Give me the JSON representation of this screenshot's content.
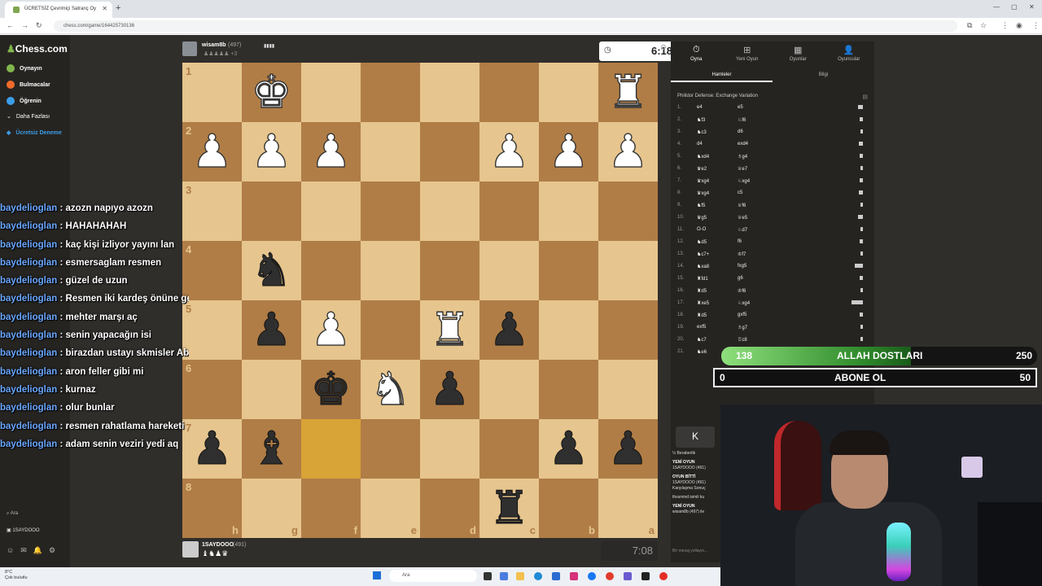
{
  "browser": {
    "tab_title": "ÜCRETSİZ Çevrimiçi Satranç Oy",
    "url": "chess.com/game/164425730136"
  },
  "sidebar": {
    "logo": "Chess.com",
    "items": [
      {
        "label": "Oynayın",
        "color": "#81b64c"
      },
      {
        "label": "Bulmacalar",
        "color": "#f06b2b"
      },
      {
        "label": "Öğrenin",
        "color": "#3b9ee8"
      },
      {
        "label": "Daha Fazlası",
        "color": "#888888"
      },
      {
        "label": "Ücretsiz Deneme",
        "color": "#3b9ee8"
      }
    ],
    "search_label": "Ara",
    "username": "1SAYDOOO"
  },
  "chat": [
    {
      "user": "baydelioglan",
      "text": "azozn napıyo azozn"
    },
    {
      "user": "baydelioglan",
      "text": "HAHAHAHAH"
    },
    {
      "user": "baydelioglan",
      "text": "kaç kişi izliyor yayını lan"
    },
    {
      "user": "baydelioglan",
      "text": "esmersaglam resmen"
    },
    {
      "user": "baydelioglan",
      "text": "güzel de uzun"
    },
    {
      "user": "baydelioglan",
      "text": "Resmen iki kardeş önüne geleni"
    },
    {
      "user": "baydelioglan",
      "text": "mehter marşı aç"
    },
    {
      "user": "baydelioglan",
      "text": "senin yapacağın isi"
    },
    {
      "user": "baydelioglan",
      "text": "birazdan ustayı skmisler Abdülhey olcak"
    },
    {
      "user": "baydelioglan",
      "text": "aron feller gibi mi"
    },
    {
      "user": "baydelioglan",
      "text": "kurnaz"
    },
    {
      "user": "baydelioglan",
      "text": "olur bunlar"
    },
    {
      "user": "baydelioglan",
      "text": "resmen rahatlama hareketi"
    },
    {
      "user": "baydelioglan",
      "text": "adam senin veziri yedi aq"
    }
  ],
  "top_player": {
    "name": "wisam8b",
    "rating": "(497)",
    "clock": "6:18",
    "captured": "♟♟♟♟♟ +3"
  },
  "bottom_player": {
    "name": "1SAYDOOO",
    "rating": "(491)",
    "clock": "7:08",
    "captured": "♝♞♟♛"
  },
  "board": {
    "ranks": [
      "1",
      "2",
      "3",
      "4",
      "5",
      "6",
      "7",
      "8"
    ],
    "files": [
      "h",
      "g",
      "f",
      "e",
      "d",
      "c",
      "b",
      "a"
    ],
    "rows": [
      [
        "",
        "♚w",
        "",
        "",
        "",
        "",
        "",
        "♜w"
      ],
      [
        "♟w",
        "♟w",
        "♟w",
        "",
        "",
        "♟w",
        "♟w",
        "♟w"
      ],
      [
        "",
        "",
        "",
        "",
        "",
        "",
        "",
        ""
      ],
      [
        "",
        "♞b",
        "",
        "",
        "",
        "",
        "",
        ""
      ],
      [
        "",
        "♟b",
        "♟w",
        "",
        "♜w",
        "♟b",
        "",
        ""
      ],
      [
        "",
        "",
        "♚b",
        "♞w",
        "♟b",
        "",
        "",
        ""
      ],
      [
        "♟b",
        "♝b",
        "",
        "",
        "",
        "",
        "♟b",
        "♟b"
      ],
      [
        "",
        "",
        "",
        "",
        "",
        "♜b",
        "",
        ""
      ]
    ],
    "highlight": [
      6,
      2
    ]
  },
  "panel": {
    "tabs": [
      {
        "icon": "⏱",
        "label": "Oyna"
      },
      {
        "icon": "⊞",
        "label": "Yeni Oyun"
      },
      {
        "icon": "▦",
        "label": "Oyunlar"
      },
      {
        "icon": "👤",
        "label": "Oyuncular"
      }
    ],
    "subtabs": [
      "Hamleler",
      "Bilgi"
    ],
    "opening": "Philidor Defense: Exchange Variation",
    "moves": [
      {
        "n": "1.",
        "w": "e4",
        "b": "e5",
        "bar": 6
      },
      {
        "n": "2.",
        "w": "♞f3",
        "b": "♘f6",
        "bar": 4
      },
      {
        "n": "3.",
        "w": "♞c3",
        "b": "d6",
        "bar": 3
      },
      {
        "n": "4.",
        "w": "d4",
        "b": "exd4",
        "bar": 5
      },
      {
        "n": "5.",
        "w": "♞xd4",
        "b": "♗g4",
        "bar": 4
      },
      {
        "n": "6.",
        "w": "♛e2",
        "b": "♕e7",
        "bar": 3
      },
      {
        "n": "7.",
        "w": "♛xg4",
        "b": "♘xg4",
        "bar": 4
      },
      {
        "n": "8.",
        "w": "♛xg4",
        "b": "c5",
        "bar": 5
      },
      {
        "n": "9.",
        "w": "♞f5",
        "b": "♕f6",
        "bar": 3
      },
      {
        "n": "10.",
        "w": "♛g5",
        "b": "♕e5",
        "bar": 6
      },
      {
        "n": "11.",
        "w": "O-O",
        "b": "♘d7",
        "bar": 3
      },
      {
        "n": "12.",
        "w": "♞d5",
        "b": "f6",
        "bar": 4
      },
      {
        "n": "13.",
        "w": "♞c7+",
        "b": "♔f7",
        "bar": 3
      },
      {
        "n": "14.",
        "w": "♞xa8",
        "b": "fxg5",
        "bar": 10
      },
      {
        "n": "15.",
        "w": "♜fd1",
        "b": "g6",
        "bar": 4
      },
      {
        "n": "16.",
        "w": "♜d5",
        "b": "♔f6",
        "bar": 3
      },
      {
        "n": "17.",
        "w": "♜xe5",
        "b": "♘xg4",
        "bar": 14
      },
      {
        "n": "18.",
        "w": "♜d5",
        "b": "gxf5",
        "bar": 4
      },
      {
        "n": "19.",
        "w": "exf5",
        "b": "♗g7",
        "bar": 3
      },
      {
        "n": "20.",
        "w": "♞c7",
        "b": "♖c8",
        "bar": 3
      },
      {
        "n": "21.",
        "w": "♞e6",
        "b": "",
        "bar": 3
      }
    ]
  },
  "counters": {
    "likes": {
      "current": "138",
      "title": "ALLAH DOSTLARI",
      "goal": "250",
      "fill": 0.55
    },
    "subs": {
      "current": "0",
      "title": "ABONE OL",
      "goal": "50"
    }
  },
  "game_chat": {
    "first_move_btn": "K",
    "draw_label": "½ Beraberlik",
    "lines": [
      {
        "head": "YENİ OYUN",
        "body": "1SAYDOOO (491)"
      },
      {
        "head": "OYUN BİTTİ",
        "body": "1SAYDOOO (491) Karşılaşma Sonuç"
      },
      {
        "head": "",
        "body": "thssmind isimli ku"
      },
      {
        "head": "YENİ OYUN",
        "body": "wisam8b (497) ile"
      }
    ],
    "input_placeholder": "Bir mesaj yollayın..."
  },
  "taskbar": {
    "weather_temp": "8°C",
    "weather_desc": "Çok bulutlu",
    "search": "Ara"
  }
}
